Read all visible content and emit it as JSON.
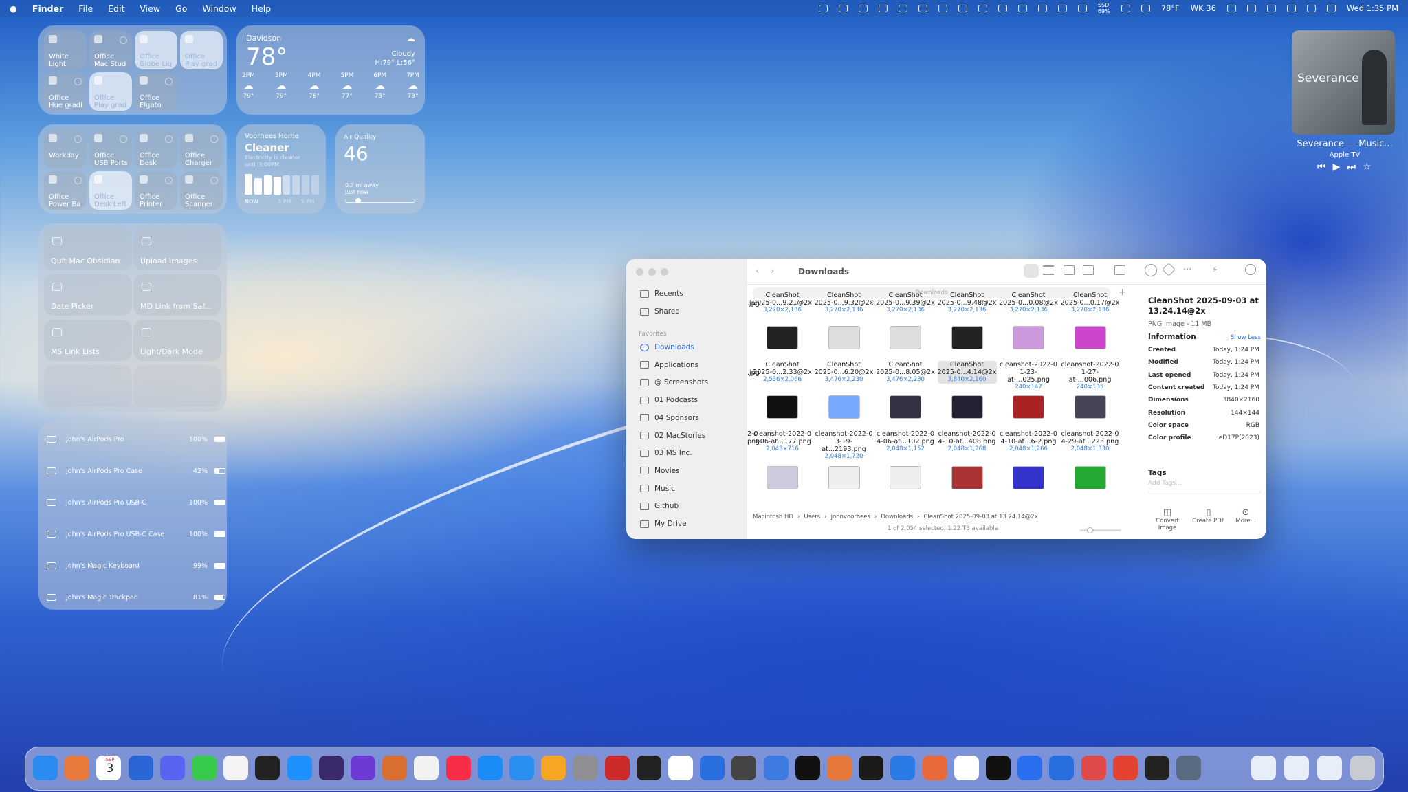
{
  "menubar": {
    "apple": "",
    "app": "Finder",
    "menus": [
      "File",
      "Edit",
      "View",
      "Go",
      "Window",
      "Help"
    ],
    "ssd": "SSD",
    "ssd_pct": "69%",
    "weather": "78°F",
    "week": "WK 36",
    "clock": "Wed 1:35 PM"
  },
  "home_tiles": [
    {
      "l1": "White",
      "l2": "Light",
      "on": false
    },
    {
      "l1": "Office",
      "l2": "Mac Stud",
      "on": false
    },
    {
      "l1": "Office",
      "l2": "Globe Lig",
      "on": true
    },
    {
      "l1": "Office",
      "l2": "Play grad",
      "on": true
    },
    {
      "l1": "Office",
      "l2": "Hue gradi",
      "on": false
    },
    {
      "l1": "Office",
      "l2": "Play grad",
      "on": true
    },
    {
      "l1": "Office",
      "l2": "Elgato",
      "on": false
    }
  ],
  "home_tiles2": [
    {
      "l1": "",
      "l2": "Workday",
      "on": false
    },
    {
      "l1": "Office",
      "l2": "USB Ports",
      "on": false
    },
    {
      "l1": "Office",
      "l2": "Desk",
      "on": false
    },
    {
      "l1": "Office",
      "l2": "Charger",
      "on": false
    },
    {
      "l1": "Office",
      "l2": "Power Ba",
      "on": false
    },
    {
      "l1": "Office",
      "l2": "Desk Left",
      "on": true
    },
    {
      "l1": "Office",
      "l2": "Printer",
      "on": false
    },
    {
      "l1": "Office",
      "l2": "Scanner",
      "on": false
    }
  ],
  "weather": {
    "city": "Davidson",
    "temp": "78°",
    "cond": "Cloudy",
    "hilo": "H:79° L:56°",
    "hours": [
      "2PM",
      "3PM",
      "4PM",
      "5PM",
      "6PM",
      "7PM"
    ],
    "temps": [
      "79°",
      "79°",
      "78°",
      "77°",
      "75°",
      "73°"
    ]
  },
  "energy": {
    "title": "Voorhees Home",
    "status": "Cleaner",
    "note": "Electricity is cleaner",
    "note2": "until 3:00PM",
    "now": "NOW",
    "t1": "3 PM",
    "t2": "5 PM"
  },
  "air": {
    "title": "Air Quality",
    "value": "46",
    "dist": "0.3 mi away",
    "when": "Just now"
  },
  "shortcuts": [
    "Quit Mac Obsidian",
    "Upload Images",
    "Date Picker",
    "MD Link from Saf...",
    "MS Link Lists",
    "Light/Dark Mode"
  ],
  "batteries": [
    {
      "name": "John's AirPods Pro",
      "pct": "100%",
      "level": 1.0
    },
    {
      "name": "John's AirPods Pro Case",
      "pct": "42%",
      "level": 0.42
    },
    {
      "name": "John's AirPods Pro USB-C",
      "pct": "100%",
      "level": 1.0
    },
    {
      "name": "John's AirPods Pro USB-C Case",
      "pct": "100%",
      "level": 1.0
    },
    {
      "name": "John's Magic Keyboard",
      "pct": "99%",
      "level": 0.99
    },
    {
      "name": "John's Magic Trackpad",
      "pct": "81%",
      "level": 0.81
    }
  ],
  "nowplaying": {
    "art": "Severance",
    "title": "Severance — Music...",
    "source": "Apple TV"
  },
  "finder": {
    "title": "Downloads",
    "search_hint": "Downloads",
    "sidebar_top": [
      "Recents",
      "Shared"
    ],
    "favorites_label": "Favorites",
    "favorites": [
      "Downloads",
      "Applications",
      "@ Screenshots",
      "01 Podcasts",
      "04 Sponsors",
      "02 MacStories",
      "03 MS Inc.",
      "Movies",
      "Music",
      "Github",
      "My Drive"
    ],
    "rows": [
      [
        {
          "n1": "CleanShot",
          "n2": "2025-0...9.21@2x",
          "d": "3,270×2,136"
        },
        {
          "n1": "CleanShot",
          "n2": "2025-0...9.32@2x",
          "d": "3,270×2,136"
        },
        {
          "n1": "CleanShot",
          "n2": "2025-0...9.39@2x",
          "d": "3,270×2,136"
        },
        {
          "n1": "CleanShot",
          "n2": "2025-0...9.48@2x",
          "d": "3,270×2,136"
        },
        {
          "n1": "CleanShot",
          "n2": "2025-0...0.08@2x",
          "d": "3,270×2,136"
        },
        {
          "n1": "CleanShot",
          "n2": "2025-0...0.17@2x",
          "d": "3,270×2,136"
        }
      ],
      [
        {
          "n1": "CleanShot",
          "n2": "2025-0...2.33@2x",
          "d": "2,536×2,066"
        },
        {
          "n1": "CleanShot",
          "n2": "2025-0...6.20@2x",
          "d": "3,476×2,230"
        },
        {
          "n1": "CleanShot",
          "n2": "2025-0...8.05@2x",
          "d": "3,476×2,230"
        },
        {
          "n1": "CleanShot",
          "n2": "2025-0...4.14@2x",
          "d": "3,840×2,160"
        },
        {
          "n1": "cleanshot-2022-0",
          "n2": "1-23-at-...025.png",
          "d": "240×147"
        },
        {
          "n1": "cleanshot-2022-0",
          "n2": "1-27-at-...006.png",
          "d": "240×135"
        }
      ],
      [
        {
          "n1": "cleanshot-2022-0",
          "n2": "3-06-at...177.png",
          "d": "2,048×716"
        },
        {
          "n1": "cleanshot-2022-0",
          "n2": "3-19-at...2193.png",
          "d": "2,048×1,720"
        },
        {
          "n1": "cleanshot-2022-0",
          "n2": "4-06-at...102.png",
          "d": "2,048×1,152"
        },
        {
          "n1": "cleanshot-2022-0",
          "n2": "4-10-at...408.png",
          "d": "2,048×1,268"
        },
        {
          "n1": "cleanshot-2022-0",
          "n2": "4-10-at...6-2.png",
          "d": "2,048×1,266"
        },
        {
          "n1": "cleanshot-2022-0",
          "n2": "4-29-at...223.png",
          "d": "2,048×1,330"
        }
      ]
    ],
    "left_edge": [
      ".jpg",
      ".jpg",
      "2-0",
      "png"
    ],
    "path": [
      "Macintosh HD",
      "Users",
      "johnvoorhees",
      "Downloads",
      "CleanShot 2025-09-03 at 13.24.14@2x"
    ],
    "status": "1 of 2,054 selected, 1.22 TB available",
    "preview": {
      "name": "CleanShot 2025-09-03 at 13.24.14@2x",
      "kind": "PNG image - 11 MB",
      "info": "Information",
      "less": "Show Less",
      "rows": [
        [
          "Created",
          "Today, 1:24 PM"
        ],
        [
          "Modified",
          "Today, 1:24 PM"
        ],
        [
          "Last opened",
          "Today, 1:24 PM"
        ],
        [
          "Content created",
          "Today, 1:24 PM"
        ],
        [
          "Dimensions",
          "3840×2160"
        ],
        [
          "Resolution",
          "144×144"
        ],
        [
          "Color space",
          "RGB"
        ],
        [
          "Color profile",
          "eD17P(2023)"
        ]
      ],
      "tags": "Tags",
      "add_tags": "Add Tags...",
      "actions": [
        "Convert Image",
        "Create PDF",
        "More..."
      ]
    }
  },
  "dock": {
    "calendar_month": "SEP",
    "calendar_day": "3"
  }
}
